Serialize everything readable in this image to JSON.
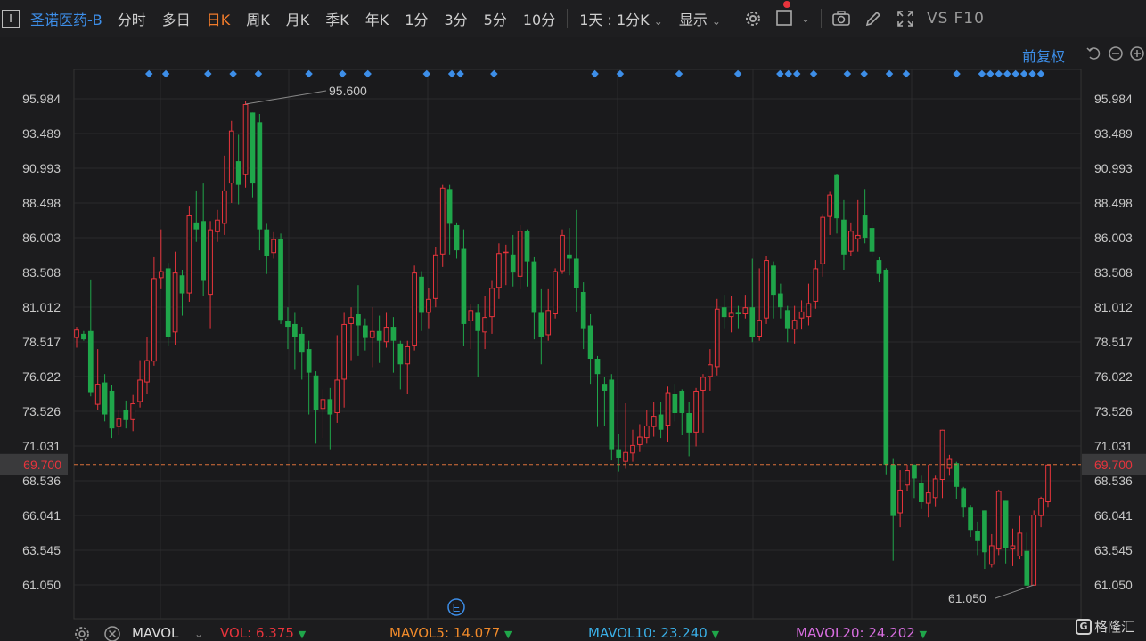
{
  "toolbar": {
    "cursor_label": "I",
    "stock_name": "圣诺医药-B",
    "tabs": [
      "分时",
      "多日",
      "日K",
      "周K",
      "月K",
      "季K",
      "年K",
      "1分",
      "3分",
      "5分",
      "10分"
    ],
    "active_tab": "日K",
    "period_selector": "1天 : 1分K",
    "display_label": "显示",
    "vs_label": "VS",
    "f10_label": "F10"
  },
  "adjust_label": "前复权",
  "chart_data": {
    "type": "candlestick",
    "y_ticks": [
      "95.984",
      "93.489",
      "90.993",
      "88.498",
      "86.003",
      "83.508",
      "81.012",
      "78.517",
      "76.022",
      "73.526",
      "71.031",
      "68.536",
      "66.041",
      "63.545",
      "61.050"
    ],
    "ylim": [
      61.05,
      95.984
    ],
    "current_price": "69.700",
    "max_label": "95.600",
    "min_label": "61.050",
    "candles": [
      [
        78.8,
        79.4,
        78.1,
        79.6
      ],
      [
        79.1,
        78.7,
        78.6,
        79.3
      ],
      [
        79.3,
        74.9,
        74.6,
        83.0
      ],
      [
        74.0,
        75.5,
        73.6,
        78.0
      ],
      [
        75.6,
        73.3,
        72.8,
        76.2
      ],
      [
        75.0,
        72.3,
        71.6,
        75.4
      ],
      [
        72.4,
        73.0,
        71.8,
        73.6
      ],
      [
        73.6,
        72.9,
        72.3,
        74.3
      ],
      [
        72.9,
        74.1,
        72.1,
        74.7
      ],
      [
        74.2,
        75.8,
        73.8,
        77.2
      ],
      [
        75.6,
        77.2,
        74.8,
        78.9
      ],
      [
        77.1,
        83.1,
        76.8,
        84.6
      ],
      [
        83.1,
        83.6,
        82.3,
        86.6
      ],
      [
        83.8,
        78.9,
        78.2,
        84.2
      ],
      [
        79.2,
        83.5,
        78.3,
        85.0
      ],
      [
        83.3,
        82.0,
        80.4,
        83.7
      ],
      [
        82.0,
        87.6,
        81.4,
        88.3
      ],
      [
        87.1,
        86.6,
        85.7,
        89.4
      ],
      [
        87.2,
        82.9,
        81.8,
        89.9
      ],
      [
        81.9,
        86.6,
        79.5,
        87.2
      ],
      [
        86.4,
        87.3,
        85.7,
        88.0
      ],
      [
        87.0,
        89.4,
        86.2,
        91.9
      ],
      [
        89.9,
        93.7,
        88.5,
        94.4
      ],
      [
        91.5,
        89.8,
        88.4,
        93.4
      ],
      [
        90.5,
        95.6,
        89.6,
        95.8
      ],
      [
        95.0,
        89.9,
        88.9,
        95.0
      ],
      [
        94.3,
        86.6,
        85.1,
        94.9
      ],
      [
        86.6,
        84.7,
        83.4,
        87.0
      ],
      [
        84.9,
        85.9,
        84.5,
        86.4
      ],
      [
        85.9,
        80.1,
        79.8,
        86.3
      ],
      [
        80.0,
        79.6,
        78.0,
        81.0
      ],
      [
        79.8,
        78.9,
        76.5,
        80.6
      ],
      [
        79.1,
        77.8,
        75.8,
        79.6
      ],
      [
        78.0,
        76.3,
        73.3,
        78.6
      ],
      [
        76.1,
        73.6,
        71.2,
        76.4
      ],
      [
        73.7,
        74.4,
        71.6,
        75.1
      ],
      [
        74.4,
        73.3,
        70.8,
        75.2
      ],
      [
        73.4,
        75.8,
        72.7,
        79.0
      ],
      [
        75.8,
        79.8,
        73.8,
        80.6
      ],
      [
        79.8,
        80.3,
        77.2,
        81.0
      ],
      [
        80.5,
        79.7,
        77.5,
        82.6
      ],
      [
        79.7,
        78.8,
        77.9,
        80.2
      ],
      [
        78.8,
        79.3,
        76.7,
        81.0
      ],
      [
        79.3,
        78.6,
        77.0,
        80.4
      ],
      [
        78.5,
        79.6,
        78.1,
        80.6
      ],
      [
        79.6,
        78.6,
        76.3,
        80.3
      ],
      [
        78.4,
        76.9,
        75.1,
        78.6
      ],
      [
        76.9,
        78.2,
        74.8,
        78.6
      ],
      [
        78.2,
        83.5,
        77.9,
        84.0
      ],
      [
        83.2,
        80.6,
        79.3,
        83.6
      ],
      [
        80.6,
        81.6,
        79.5,
        82.4
      ],
      [
        81.6,
        84.8,
        81.0,
        85.3
      ],
      [
        84.8,
        89.6,
        83.9,
        89.8
      ],
      [
        89.5,
        87.0,
        84.8,
        89.8
      ],
      [
        86.9,
        85.1,
        84.5,
        87.1
      ],
      [
        85.2,
        79.8,
        78.2,
        86.6
      ],
      [
        80.0,
        80.8,
        78.0,
        81.2
      ],
      [
        80.6,
        79.3,
        76.0,
        81.2
      ],
      [
        79.2,
        80.3,
        78.0,
        81.8
      ],
      [
        80.3,
        82.4,
        79.1,
        82.9
      ],
      [
        82.4,
        84.9,
        81.6,
        85.6
      ],
      [
        84.9,
        85.0,
        82.6,
        85.5
      ],
      [
        84.8,
        83.5,
        82.5,
        86.2
      ],
      [
        83.2,
        86.5,
        82.3,
        86.9
      ],
      [
        86.5,
        84.3,
        82.5,
        86.6
      ],
      [
        84.3,
        80.6,
        78.7,
        84.6
      ],
      [
        80.6,
        78.9,
        76.9,
        82.3
      ],
      [
        79.0,
        80.8,
        78.6,
        82.3
      ],
      [
        80.5,
        83.6,
        80.2,
        83.8
      ],
      [
        83.6,
        86.2,
        83.4,
        86.6
      ],
      [
        84.8,
        84.5,
        83.3,
        86.7
      ],
      [
        84.5,
        82.4,
        80.7,
        88.0
      ],
      [
        82.1,
        79.5,
        78.0,
        82.8
      ],
      [
        79.7,
        77.3,
        75.5,
        80.5
      ],
      [
        77.3,
        76.2,
        72.4,
        77.5
      ],
      [
        75.5,
        75.0,
        72.5,
        76.0
      ],
      [
        75.8,
        70.8,
        70.0,
        76.2
      ],
      [
        70.8,
        70.2,
        69.2,
        71.9
      ],
      [
        69.9,
        70.6,
        69.4,
        74.1
      ],
      [
        70.5,
        71.1,
        69.9,
        72.2
      ],
      [
        71.1,
        71.7,
        70.6,
        72.6
      ],
      [
        71.6,
        72.5,
        71.2,
        73.6
      ],
      [
        72.4,
        73.2,
        71.7,
        74.2
      ],
      [
        73.3,
        72.2,
        71.6,
        74.2
      ],
      [
        72.5,
        74.9,
        71.3,
        75.3
      ],
      [
        74.8,
        73.4,
        72.8,
        75.5
      ],
      [
        75.0,
        73.4,
        71.8,
        75.1
      ],
      [
        73.4,
        72.0,
        70.3,
        74.2
      ],
      [
        72.0,
        75.0,
        71.0,
        75.2
      ],
      [
        75.0,
        76.0,
        72.0,
        76.2
      ],
      [
        76.0,
        76.9,
        75.0,
        78.0
      ],
      [
        76.7,
        80.9,
        76.1,
        81.6
      ],
      [
        81.0,
        80.3,
        79.5,
        81.9
      ],
      [
        80.3,
        80.6,
        79.2,
        81.8
      ],
      [
        80.6,
        80.5,
        79.5,
        81.1
      ],
      [
        80.5,
        81.0,
        80.2,
        81.9
      ],
      [
        81.0,
        78.9,
        78.5,
        84.5
      ],
      [
        78.9,
        80.1,
        78.6,
        83.8
      ],
      [
        80.2,
        84.4,
        79.8,
        84.7
      ],
      [
        84.0,
        81.9,
        80.2,
        84.3
      ],
      [
        82.0,
        81.0,
        80.2,
        82.7
      ],
      [
        80.8,
        79.5,
        78.5,
        81.1
      ],
      [
        79.4,
        80.1,
        78.4,
        81.1
      ],
      [
        80.2,
        80.7,
        79.4,
        81.5
      ],
      [
        80.3,
        81.3,
        79.7,
        82.7
      ],
      [
        81.4,
        83.8,
        80.9,
        84.4
      ],
      [
        84.1,
        87.5,
        83.2,
        87.7
      ],
      [
        87.5,
        89.1,
        86.2,
        89.3
      ],
      [
        90.5,
        87.4,
        86.3,
        90.6
      ],
      [
        87.3,
        84.8,
        83.7,
        88.7
      ],
      [
        85.0,
        86.5,
        84.7,
        87.1
      ],
      [
        85.9,
        86.2,
        85.0,
        88.7
      ],
      [
        87.6,
        86.0,
        85.6,
        89.5
      ],
      [
        86.7,
        85.0,
        84.7,
        87.1
      ],
      [
        84.4,
        83.4,
        82.8,
        84.6
      ],
      [
        83.7,
        69.7,
        69.0,
        83.8
      ],
      [
        69.7,
        66.0,
        62.8,
        70.1
      ],
      [
        66.2,
        67.9,
        65.2,
        69.3
      ],
      [
        68.2,
        69.3,
        67.8,
        69.7
      ],
      [
        69.7,
        68.7,
        67.3,
        69.7
      ],
      [
        68.4,
        67.0,
        66.5,
        68.9
      ],
      [
        66.9,
        67.7,
        65.9,
        69.7
      ],
      [
        67.3,
        68.7,
        66.7,
        68.9
      ],
      [
        68.6,
        72.2,
        67.3,
        72.2
      ],
      [
        69.4,
        70.1,
        68.9,
        70.4
      ],
      [
        69.8,
        68.1,
        67.2,
        69.9
      ],
      [
        68.0,
        66.6,
        65.9,
        68.1
      ],
      [
        66.6,
        65.0,
        64.5,
        66.8
      ],
      [
        64.9,
        64.2,
        63.2,
        65.6
      ],
      [
        66.4,
        63.4,
        62.2,
        66.4
      ],
      [
        62.5,
        63.9,
        62.3,
        64.7
      ],
      [
        63.6,
        67.8,
        63.2,
        67.9
      ],
      [
        67.1,
        63.7,
        62.6,
        67.1
      ],
      [
        63.6,
        63.9,
        62.4,
        65.1
      ],
      [
        63.1,
        64.8,
        62.9,
        66.0
      ],
      [
        63.5,
        61.0,
        61.0,
        64.8
      ],
      [
        61.0,
        66.1,
        61.0,
        66.4
      ],
      [
        66.0,
        67.3,
        65.2,
        67.4
      ],
      [
        67.0,
        69.7,
        66.6,
        69.7
      ]
    ],
    "event_marks": [
      5,
      7,
      12,
      15,
      18,
      24,
      28,
      31,
      38,
      41,
      42,
      46,
      58,
      61,
      68,
      75,
      80,
      81,
      82,
      84,
      88,
      90,
      93,
      95,
      101,
      104,
      105,
      106,
      107,
      108,
      109,
      110,
      111
    ]
  },
  "bottom": {
    "indicator": "MAVOL",
    "vol": "VOL: 6.375",
    "mavol5": "MAVOL5: 14.077",
    "mavol10": "MAVOL10: 23.240",
    "mavol20": "MAVOL20: 24.202",
    "colors": {
      "vol": "#e8343c",
      "mavol5": "#f08a2b",
      "mavol10": "#3ab0e8",
      "mavol20": "#d86ee0"
    }
  },
  "event_label": "E",
  "logo_text": "格隆汇",
  "colors": {
    "up": "#e8343c",
    "down": "#1fa64a",
    "accent": "#3d8ee8",
    "active_tab": "#f07b2b"
  }
}
